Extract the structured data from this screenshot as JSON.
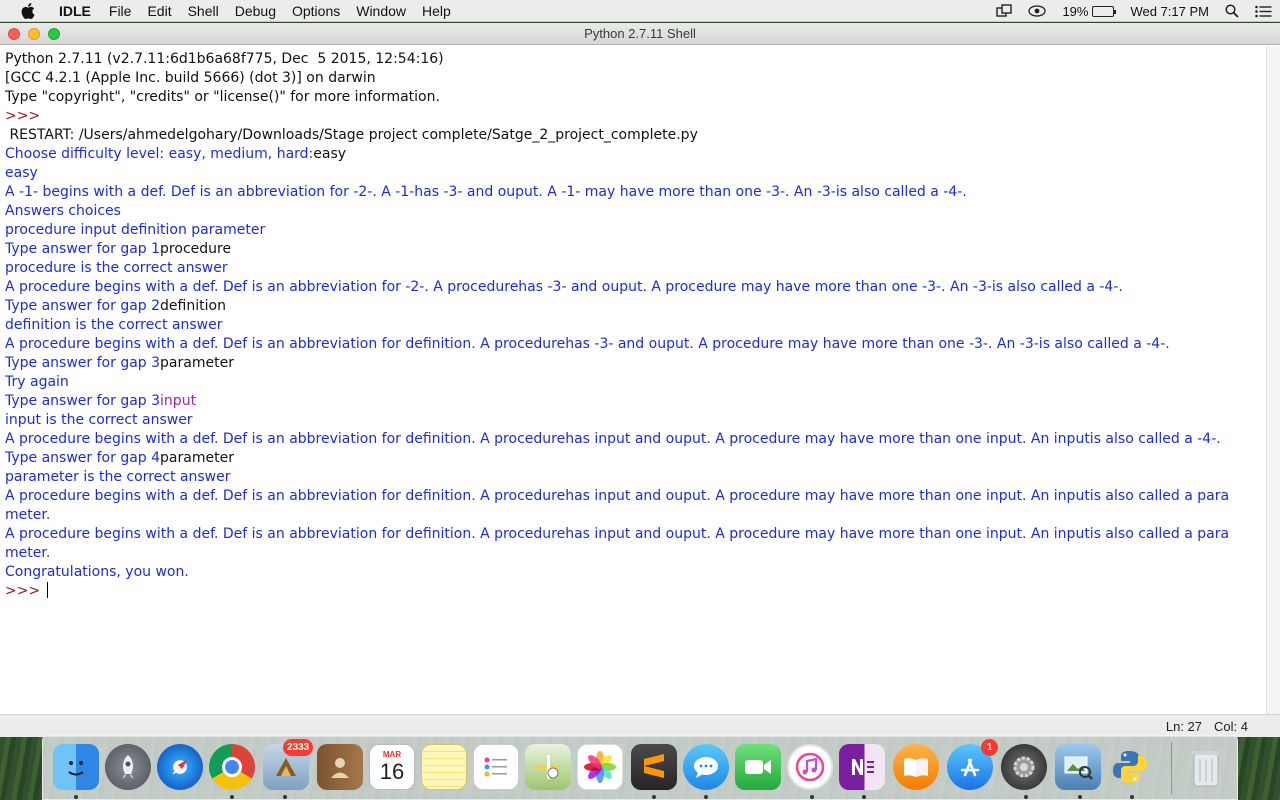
{
  "menubar": {
    "app": "IDLE",
    "items": [
      "File",
      "Edit",
      "Shell",
      "Debug",
      "Options",
      "Window",
      "Help"
    ],
    "battery": "19%",
    "battery_level": 0.19,
    "clock": "Wed 7:17 PM"
  },
  "window": {
    "title": "Python 2.7.11 Shell"
  },
  "shell": {
    "lines": [
      [
        {
          "t": "Python 2.7.11 (v2.7.11:6d1b6a68f775, Dec  5 2015, 12:54:16) ",
          "c": "k"
        }
      ],
      [
        {
          "t": "[GCC 4.2.1 (Apple Inc. build 5666) (dot 3)] on darwin",
          "c": "k"
        }
      ],
      [
        {
          "t": "Type \"copyright\", \"credits\" or \"license()\" for more information.",
          "c": "k"
        }
      ],
      [
        {
          "t": ">>> ",
          "c": "p"
        }
      ],
      [
        {
          "t": " RESTART: /Users/ahmedelgohary/Downloads/Stage project complete/Satge_2_project_complete.py",
          "c": "k"
        }
      ],
      [
        {
          "t": "Choose difficulty level: easy, medium, hard:",
          "c": "b"
        },
        {
          "t": "easy",
          "c": "k"
        }
      ],
      [
        {
          "t": "easy",
          "c": "b"
        }
      ],
      [
        {
          "t": "A -1- begins with a def. Def is an abbreviation for -2-. A -1-has -3- and ouput. A -1- may have more than one -3-. An -3-is also called a -4-.",
          "c": "b"
        }
      ],
      [
        {
          "t": "Answers choices",
          "c": "b"
        }
      ],
      [
        {
          "t": "procedure input definition parameter",
          "c": "b"
        }
      ],
      [
        {
          "t": "Type answer for gap 1",
          "c": "b"
        },
        {
          "t": "procedure",
          "c": "k"
        }
      ],
      [
        {
          "t": "procedure is the correct answer",
          "c": "b"
        }
      ],
      [
        {
          "t": "A procedure begins with a def. Def is an abbreviation for -2-. A procedurehas -3- and ouput. A procedure may have more than one -3-. An -3-is also called a -4-.",
          "c": "b"
        }
      ],
      [
        {
          "t": "Type answer for gap 2",
          "c": "b"
        },
        {
          "t": "definition",
          "c": "k"
        }
      ],
      [
        {
          "t": "definition is the correct answer",
          "c": "b"
        }
      ],
      [
        {
          "t": "A procedure begins with a def. Def is an abbreviation for definition. A procedurehas -3- and ouput. A procedure may have more than one -3-. An -3-is also called a -4-.",
          "c": "b"
        }
      ],
      [
        {
          "t": "Type answer for gap 3",
          "c": "b"
        },
        {
          "t": "parameter",
          "c": "k"
        }
      ],
      [
        {
          "t": "Try again",
          "c": "b"
        }
      ],
      [
        {
          "t": "Type answer for gap 3",
          "c": "b"
        },
        {
          "t": "input",
          "c": "m"
        }
      ],
      [
        {
          "t": "input is the correct answer",
          "c": "b"
        }
      ],
      [
        {
          "t": "A procedure begins with a def. Def is an abbreviation for definition. A procedurehas input and ouput. A procedure may have more than one input. An inputis also called a -4-.",
          "c": "b"
        }
      ],
      [
        {
          "t": "Type answer for gap 4",
          "c": "b"
        },
        {
          "t": "parameter",
          "c": "k"
        }
      ],
      [
        {
          "t": "parameter is the correct answer",
          "c": "b"
        }
      ],
      [
        {
          "t": "A procedure begins with a def. Def is an abbreviation for definition. A procedurehas input and ouput. A procedure may have more than one input. An inputis also called a para",
          "c": "b"
        }
      ],
      [
        {
          "t": "meter.",
          "c": "b"
        }
      ],
      [
        {
          "t": "A procedure begins with a def. Def is an abbreviation for definition. A procedurehas input and ouput. A procedure may have more than one input. An inputis also called a para",
          "c": "b"
        }
      ],
      [
        {
          "t": "meter.",
          "c": "b"
        }
      ],
      [
        {
          "t": "Congratulations, you won.",
          "c": "b"
        }
      ],
      [
        {
          "t": ">>> ",
          "c": "p"
        }
      ]
    ]
  },
  "statusbar": {
    "line": "Ln: 27",
    "col": "Col: 4"
  },
  "dock": {
    "mail_badge": "2333",
    "calendar_month": "MAR",
    "calendar_day": "16",
    "appstore_badge": "1"
  },
  "colors": {
    "shell_output": "#1d2cd6",
    "prompt": "#8b1a1a",
    "user_input": "#111111",
    "highlight_input": "#9a2aa0"
  }
}
